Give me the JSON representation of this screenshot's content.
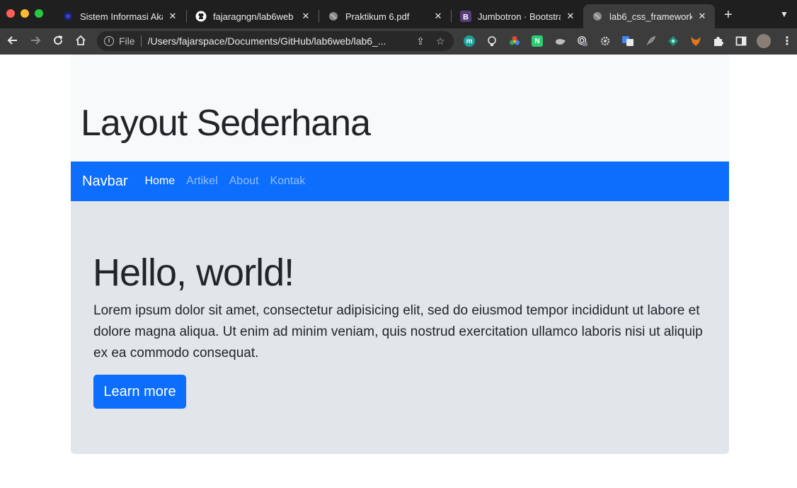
{
  "browser": {
    "tabs": [
      {
        "title": "Sistem Informasi Akad",
        "icon": "campus-icon"
      },
      {
        "title": "fajaragngn/lab6web",
        "icon": "github-icon"
      },
      {
        "title": "Praktikum 6.pdf",
        "icon": "globe-icon"
      },
      {
        "title": "Jumbotron · Bootstrap",
        "icon": "bootstrap-icon"
      },
      {
        "title": "lab6_css_framework",
        "icon": "globe-icon",
        "active": true
      }
    ],
    "address": {
      "scheme": "File",
      "url": "/Users/fajarspace/Documents/GitHub/lab6web/lab6_..."
    },
    "extensions": [
      "m",
      "N"
    ]
  },
  "page": {
    "header_title": "Layout Sederhana",
    "navbar": {
      "brand": "Navbar",
      "links": [
        {
          "label": "Home",
          "active": true
        },
        {
          "label": "Artikel"
        },
        {
          "label": "About"
        },
        {
          "label": "Kontak"
        }
      ]
    },
    "jumbotron": {
      "heading": "Hello, world!",
      "lead": "Lorem ipsum dolor sit amet, consectetur adipisicing elit, sed do eiusmod tempor incididunt ut labore et dolore magna aliqua. Ut enim ad minim veniam, quis nostrud exercitation ullamco laboris nisi ut aliquip ex ea commodo consequat.",
      "button": "Learn more"
    }
  },
  "colors": {
    "primary": "#0d6efd",
    "header_bg": "#f8f9fa",
    "jumbotron_bg": "#e2e5ea"
  }
}
